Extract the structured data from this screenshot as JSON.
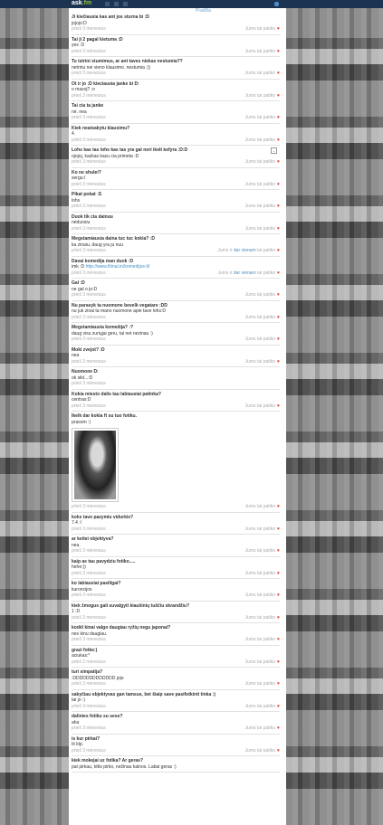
{
  "header": {
    "logo_main": "ask",
    "logo_accent": ".fm",
    "breadcrumb": "Pradžia"
  },
  "colors": {
    "topbar": "#1c3452",
    "link": "#4a90c4",
    "heart": "#e53b3b"
  },
  "items": [
    {
      "q": "Ji kiečiausia kas ant jos sturna bi :D",
      "a": "jojojo:D",
      "time": "prieš 3 mėnesius",
      "likes": "Jums tai patiko"
    },
    {
      "q": "Tai ji 2 pagal kietuma :D",
      "a": "yes :D",
      "time": "prieš 3 mėnesius",
      "likes": "Jums tai patiko"
    },
    {
      "q": "Tu istrini stumimus, ar ant taves niekas nestumia??",
      "a": "netrinu nei vieno klausimo. nestumia :))",
      "time": "prieš 3 mėnesius",
      "likes": "Jums tai patiko"
    },
    {
      "q": "Ot ir jo :D kieciausia janke bi D:",
      "a": "o mazoj? ;o",
      "time": "prieš 3 mėnesius",
      "likes": "Jums tai patiko"
    },
    {
      "q": "Tai cia ta janke",
      "a": "nė. nea",
      "time": "prieš 3 mėnesius",
      "likes": "Jums tai patiko"
    },
    {
      "q": "Kiek neatsakytu klausimu?",
      "a": "4.",
      "time": "prieš 3 mėnesius",
      "likes": "Jums tai patiko"
    },
    {
      "q": "Lohs kas tas lohs kas tas yra gal nori ikelt kefyra :D:D",
      "a": "ojojoj, kazkas kazu cia primeta :D",
      "time": "prieš 3 mėnesius",
      "likes": "Jums tai patiko",
      "dropdown": true
    },
    {
      "q": "Ko ne shulei?",
      "a": "sergu:/",
      "time": "prieš 3 mėnesius",
      "likes": "Jums tai patiko"
    },
    {
      "q": "Pikat pokat :S",
      "a": "lohs",
      "time": "prieš 3 mėnesius",
      "likes": "Jums tai patiko"
    },
    {
      "q": "Duok tik cia dainuu",
      "a": "nėduosiu",
      "time": "prieš 3 mėnesius",
      "likes": "Jums tai patiko"
    },
    {
      "q": "Megstamiausia daina tuc tuc kokia? :D",
      "a": "ka zinaiu, daug yra ju nuu",
      "time": "prieš 3 mėnesius",
      "likes_pre": "Jums ir",
      "likes_link": "dar vienam",
      "likes_post": "tai patiko"
    },
    {
      "q": "Davai komedija man duok :D",
      "a": "imk :D",
      "link": "http://www.filmai.in/komedijos-lt/",
      "time": "prieš 3 mėnesius",
      "likes_pre": "Jums ir",
      "likes_link": "dar vienam",
      "likes_post": "tai patiko"
    },
    {
      "q": "Gal :D",
      "a": "ne gal o jo:D",
      "time": "prieš 3 mėnesius",
      "likes": "Jums tai patiko"
    },
    {
      "q": "Nu parasyk ta nuomone bevelk vegatare :DD",
      "a": "nu juk zinai ta mano nuomone apie tave lohs:D",
      "time": "prieš 3 mėnesius",
      "likes": "Jums tai patiko"
    },
    {
      "q": "Megstamiausia komedija? :?",
      "a": "daug visu zuriųjai geru, tai net nezinau :)",
      "time": "prieš 3 mėnesius",
      "likes": "Jums tai patiko"
    },
    {
      "q": "Moki zvejot? :D",
      "a": "nea",
      "time": "prieš 3 mėnesius",
      "likes": "Jums tai patiko"
    },
    {
      "q": "Nuomone D:",
      "a": "ok sikt...:D",
      "time": "prieš 3 mėnesius"
    },
    {
      "q": "Kokia miesto dalis tau labiausiai patinka?",
      "a": "centras:D",
      "time": "prieš 3 mėnesius",
      "likes": "Jums tai patiko"
    },
    {
      "q": "Ikelk dar kokia ft su tuo fotiku.",
      "a": "prasom :)",
      "photo": true,
      "time": "prieš 3 mėnesius",
      "likes": "Jums tai patiko"
    },
    {
      "q": "koks tavo pazymiu vidurkis?",
      "a": "7.4 :/",
      "time": "prieš 3 mėnesius",
      "likes": "Jums tai patiko"
    },
    {
      "q": "ar keitei objektyva?",
      "a": "nea.",
      "time": "prieš 3 mėnesius",
      "likes": "Jums tai patiko"
    },
    {
      "q": "kaip as tau pavydziu fotiko.....",
      "a": "hehe:))",
      "time": "prieš 3 mėnesius",
      "likes": "Jums tai patiko"
    },
    {
      "q": "ko labiausiai pasiilgai?",
      "a": "kuroncijos",
      "time": "prieš 3 mėnesius",
      "likes": "Jums tai patiko"
    },
    {
      "q": "kiek žmogus gali suvalgyti kiaušinių tuščiu skrandžiu?",
      "a": "1 :D",
      "time": "prieš 3 mėnesius",
      "likes": "Jums tai patiko"
    },
    {
      "q": "kodėl kinai valgo daugiau ryžių negu japonai?",
      "a": "nes kinu daugiau.",
      "time": "prieš 3 mėnesius",
      "likes": "Jums tai patiko"
    },
    {
      "q": "grazi fotke:)",
      "a": "aciukas:*",
      "time": "prieš 3 mėnesius",
      "likes": "Jums tai patiko"
    },
    {
      "q": "turi simpatija?",
      "a": ":DDDDDDDDDDDDD jojo",
      "time": "prieš 3 mėnesius",
      "likes": "Jums tai patiko"
    },
    {
      "q": "sakyčiau objektyvas gan tamsus, bet šiaip save pasifotkinti tinka :)",
      "a": "tai jo :)",
      "time": "prieš 3 mėnesius",
      "likes": "Jums tai patiko"
    },
    {
      "q": "dalinies fotiku su sese?",
      "a": "aha",
      "time": "prieš 3 mėnesius",
      "likes": "Jums tai patiko"
    },
    {
      "q": "is kur pirkai?",
      "a": "Iš klp.",
      "time": "prieš 3 mėnesius",
      "likes": "Jums tai patiko"
    },
    {
      "q": "kiek mokejai uz fotika? Ar geras?",
      "a": "pat pirkau, tėtis pirko, nežinau kainos. Labai geras :)",
      "time": "",
      "likes": ""
    }
  ]
}
